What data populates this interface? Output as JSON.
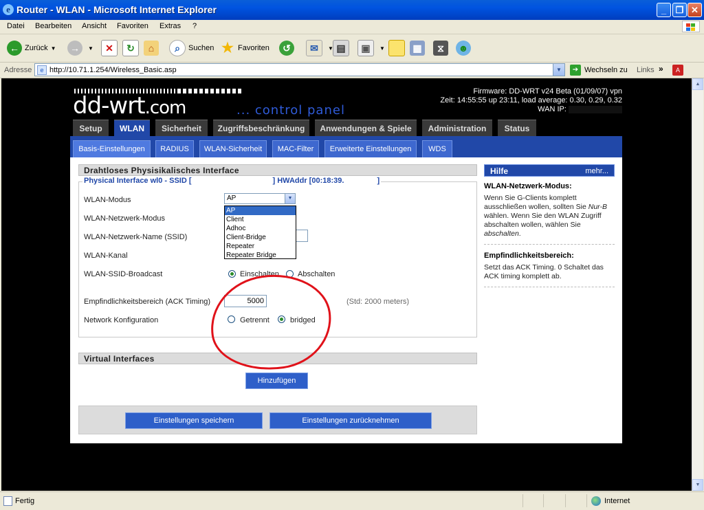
{
  "window": {
    "title": "Router - WLAN - Microsoft Internet Explorer"
  },
  "menu": [
    "Datei",
    "Bearbeiten",
    "Ansicht",
    "Favoriten",
    "Extras",
    "?"
  ],
  "toolbar": {
    "back": "Zurück",
    "search": "Suchen",
    "favorites": "Favoriten"
  },
  "address": {
    "label": "Adresse",
    "url": "http://10.71.1.254/Wireless_Basic.asp",
    "go": "Wechseln zu",
    "links": "Links"
  },
  "router": {
    "logo": "dd-wrt",
    "logo_suffix": ".com",
    "tagline": "... control panel",
    "firmware": "Firmware: DD-WRT v24 Beta (01/09/07) vpn",
    "time": "Zeit: 14:55:55 up 23:11, load average: 0.30, 0.29, 0.32",
    "wan_ip_label": "WAN IP:"
  },
  "tabs": [
    "Setup",
    "WLAN",
    "Sicherheit",
    "Zugriffsbeschränkung",
    "Anwendungen & Spiele",
    "Administration",
    "Status"
  ],
  "subtabs": [
    "Basis-Einstellungen",
    "RADIUS",
    "WLAN-Sicherheit",
    "MAC-Filter",
    "Erweiterte Einstellungen",
    "WDS"
  ],
  "section1": {
    "title": "Drahtloses Physisikalisches Interface",
    "legend_left": "Physical Interface wl0 - SSID [",
    "legend_right": "] HWAddr [00:18:39.",
    "legend_close": "]",
    "labels": {
      "mode": "WLAN-Modus",
      "net_mode": "WLAN-Netzwerk-Modus",
      "ssid": "WLAN-Netzwerk-Name (SSID)",
      "channel": "WLAN-Kanal",
      "broadcast": "WLAN-SSID-Broadcast",
      "ack": "Empfindlichkeitsbereich (ACK Timing)",
      "netconf": "Network Konfiguration"
    },
    "mode_value": "AP",
    "mode_options": [
      "AP",
      "Client",
      "Adhoc",
      "Client-Bridge",
      "Repeater",
      "Repeater Bridge"
    ],
    "broadcast_on": "Einschalten",
    "broadcast_off": "Abschalten",
    "ack_value": "5000",
    "ack_hint": "(Std: 2000 meters)",
    "net_separated": "Getrennt",
    "net_bridged": "bridged"
  },
  "section2": {
    "title": "Virtual Interfaces",
    "add_button": "Hinzufügen"
  },
  "buttons": {
    "save": "Einstellungen speichern",
    "cancel": "Einstellungen zurücknehmen"
  },
  "help": {
    "title": "Hilfe",
    "more": "mehr...",
    "h1": "WLAN-Netzwerk-Modus:",
    "p1_a": "Wenn Sie G-Clients komplett ausschließen wollen, sollten Sie ",
    "p1_em": "Nur-B",
    "p1_b": " wählen. Wenn Sie den WLAN Zugriff abschalten wollen, wählen Sie ",
    "p1_em2": "abschalten",
    "p1_c": ".",
    "h2": "Empfindlichkeitsbereich:",
    "p2": "Setzt das ACK Timing. 0 Schaltet das ACK timing komplett ab."
  },
  "status": {
    "text": "Fertig",
    "zone": "Internet"
  }
}
